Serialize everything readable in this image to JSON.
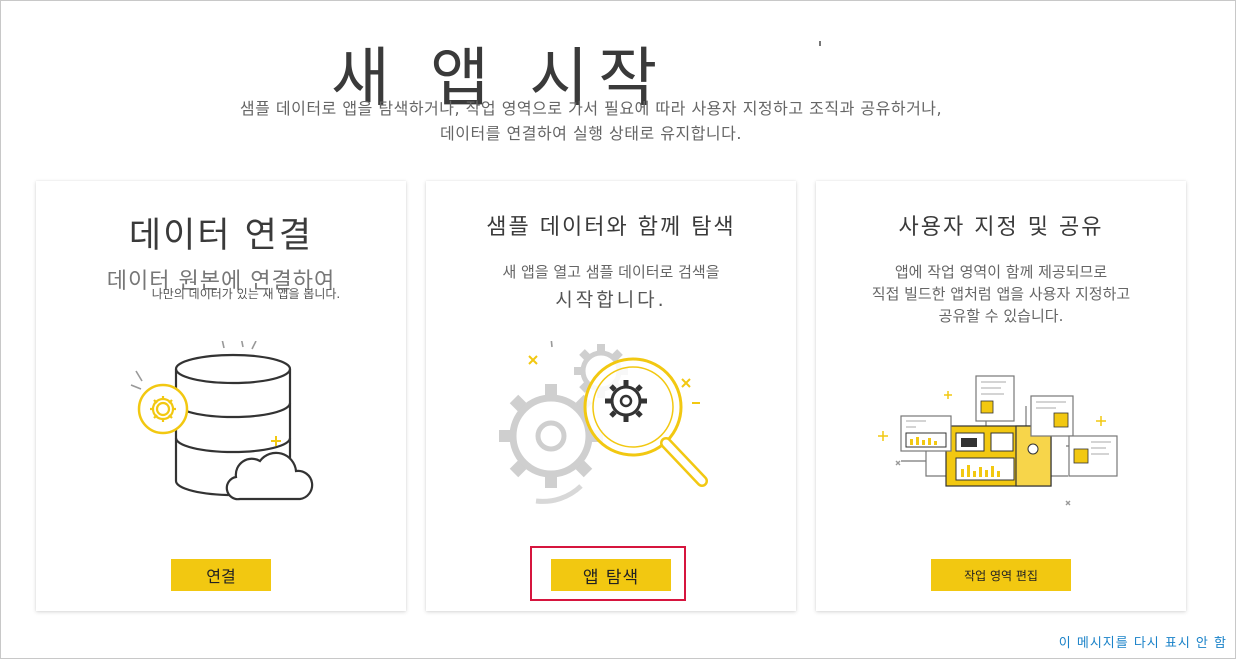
{
  "page": {
    "title": "새 앱 시작",
    "subtitle_line1": "샘플 데이터로 앱을 탐색하거나, 작업 영역으로 가서 필요에 따라 사용자 지정하고 조직과 공유하거나,",
    "subtitle_line2": "데이터를 연결하여 실행 상태로 유지합니다."
  },
  "cards": [
    {
      "title": "데이터 연결",
      "desc_line1": "데이터 원본에 연결하여",
      "desc_line2": "나만의 데이터가 있는 새 앱을 봅니다.",
      "button_label": "연결",
      "illustration": "database-cloud-gear-icon"
    },
    {
      "title": "샘플 데이터와 함께 탐색",
      "desc_line1": "새 앱을 열고 샘플 데이터로 검색을",
      "desc_line2": "시작합니다.",
      "button_label": "앱 탐색",
      "illustration": "magnifier-gears-icon"
    },
    {
      "title": "사용자 지정 및 공유",
      "desc_line1": "앱에 작업 영역이 함께 제공되므로",
      "desc_line2": "직접 빌드한 앱처럼 앱을 사용자 지정하고",
      "desc_line3": "공유할 수 있습니다.",
      "button_label": "작업 영역 편집",
      "illustration": "dashboard-tiles-icon"
    }
  ],
  "footer": {
    "dismiss_label": "이 메시지를 다시 표시 안 함"
  },
  "colors": {
    "accent": "#f2c811",
    "highlight": "#d6153e",
    "link": "#1a82c8"
  }
}
